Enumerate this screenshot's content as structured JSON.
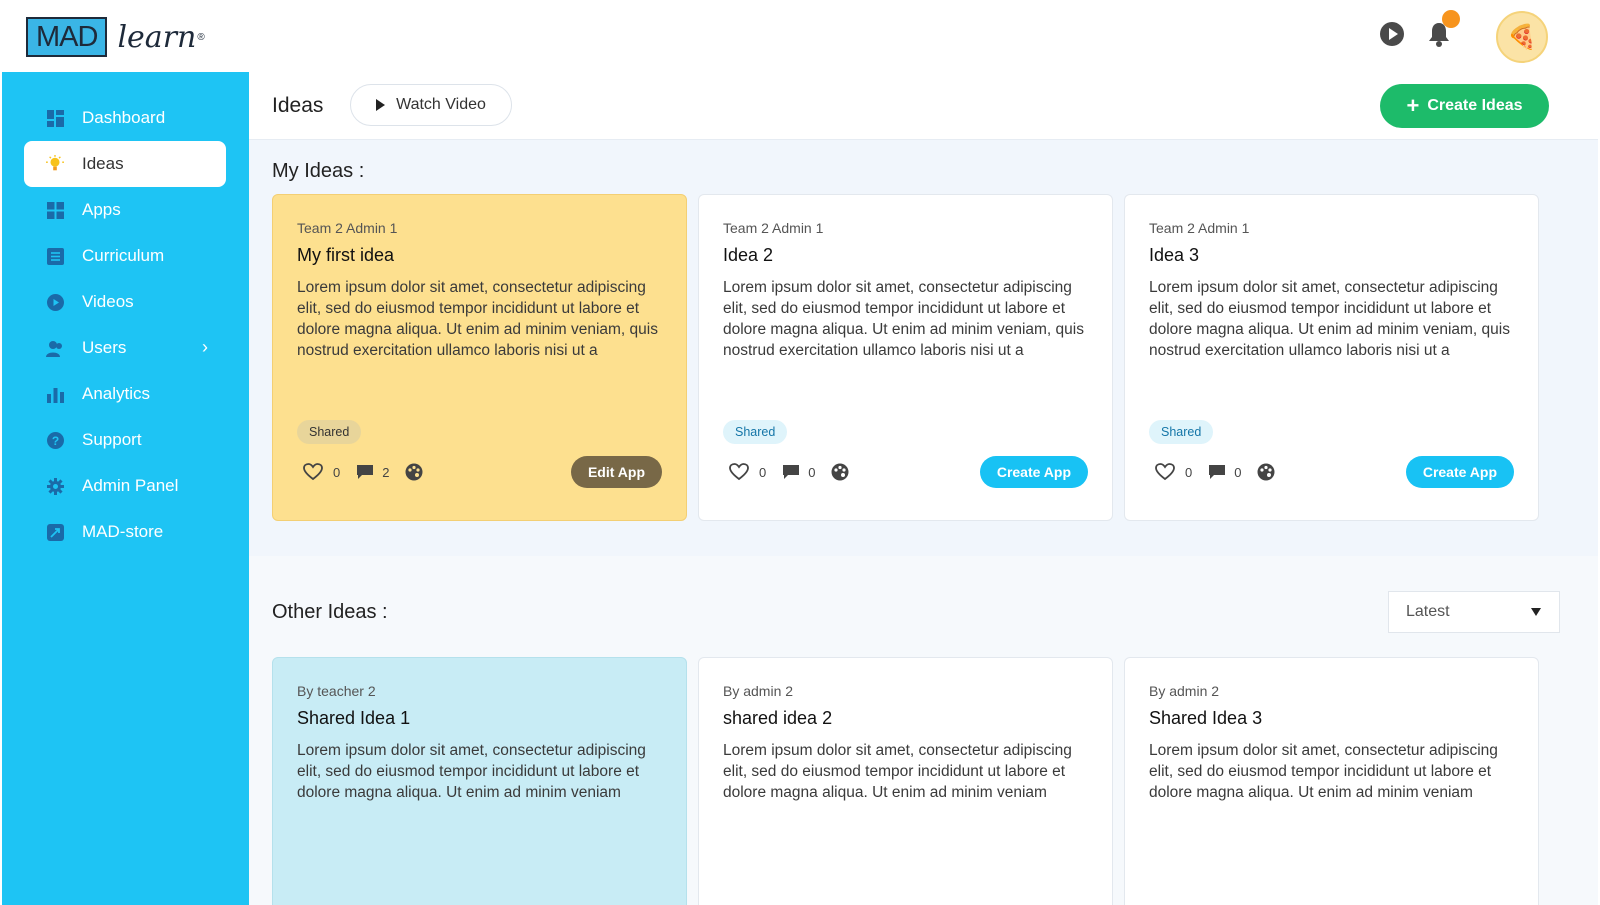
{
  "app": {
    "logo_primary": "MAD",
    "logo_secondary": "learn",
    "logo_mark": "®"
  },
  "topbar": {
    "icons": [
      "play-icon",
      "bell-icon"
    ],
    "notification_dot_color": "#f7941d",
    "avatar_emoji": "🍕"
  },
  "sidebar": {
    "items": [
      {
        "label": "Dashboard",
        "icon": "dashboard-icon"
      },
      {
        "label": "Ideas",
        "icon": "lightbulb-icon",
        "active": true
      },
      {
        "label": "Apps",
        "icon": "apps-icon"
      },
      {
        "label": "Curriculum",
        "icon": "curriculum-icon"
      },
      {
        "label": "Videos",
        "icon": "video-icon"
      },
      {
        "label": "Users",
        "icon": "users-icon",
        "chevron": "›"
      },
      {
        "label": "Analytics",
        "icon": "analytics-icon"
      },
      {
        "label": "Support",
        "icon": "support-icon"
      },
      {
        "label": "Admin Panel",
        "icon": "gear-icon"
      },
      {
        "label": "MAD-store",
        "icon": "store-icon"
      }
    ],
    "background_color": "#1ec4f4"
  },
  "header": {
    "title": "Ideas",
    "watch_video_label": "Watch Video",
    "create_ideas_label": "Create Ideas",
    "create_ideas_plus": "+",
    "accent_color": "#1dbb6a"
  },
  "my_ideas": {
    "title": "My Ideas :",
    "cards": [
      {
        "author": "Team 2 Admin 1",
        "title": "My first idea",
        "body": "Lorem ipsum dolor sit amet, consectetur adipiscing elit, sed do eiusmod tempor incididunt ut labore et dolore magna aliqua. Ut enim ad minim veniam, quis nostrud exercitation ullamco laboris nisi ut a",
        "badge": "Shared",
        "likes": "0",
        "comments": "2",
        "action": "Edit App"
      },
      {
        "author": "Team 2 Admin 1",
        "title": "Idea 2",
        "body": "Lorem ipsum dolor sit amet, consectetur adipiscing elit, sed do eiusmod tempor incididunt ut labore et dolore magna aliqua. Ut enim ad minim veniam, quis nostrud exercitation ullamco laboris nisi ut a",
        "badge": "Shared",
        "likes": "0",
        "comments": "0",
        "action": "Create App"
      },
      {
        "author": "Team 2 Admin 1",
        "title": "Idea 3",
        "body": "Lorem ipsum dolor sit amet, consectetur adipiscing elit, sed do eiusmod tempor incididunt ut labore et dolore magna aliqua. Ut enim ad minim veniam, quis nostrud exercitation ullamco laboris nisi ut a",
        "badge": "Shared",
        "likes": "0",
        "comments": "0",
        "action": "Create App"
      }
    ]
  },
  "other_ideas": {
    "title": "Other Ideas :",
    "sort_value": "Latest",
    "cards": [
      {
        "author": "By teacher 2",
        "title": "Shared Idea 1",
        "body": "Lorem ipsum dolor sit amet, consectetur adipiscing elit, sed do eiusmod tempor incididunt ut labore et dolore magna aliqua. Ut enim ad minim veniam"
      },
      {
        "author": "By admin 2",
        "title": "shared idea 2",
        "body": "Lorem ipsum dolor sit amet, consectetur adipiscing elit, sed do eiusmod tempor incididunt ut labore et dolore magna aliqua. Ut enim ad minim veniam"
      },
      {
        "author": "By admin 2",
        "title": "Shared Idea 3",
        "body": "Lorem ipsum dolor sit amet, consectetur adipiscing elit, sed do eiusmod tempor incididunt ut labore et dolore magna aliqua. Ut enim ad minim veniam"
      }
    ]
  }
}
